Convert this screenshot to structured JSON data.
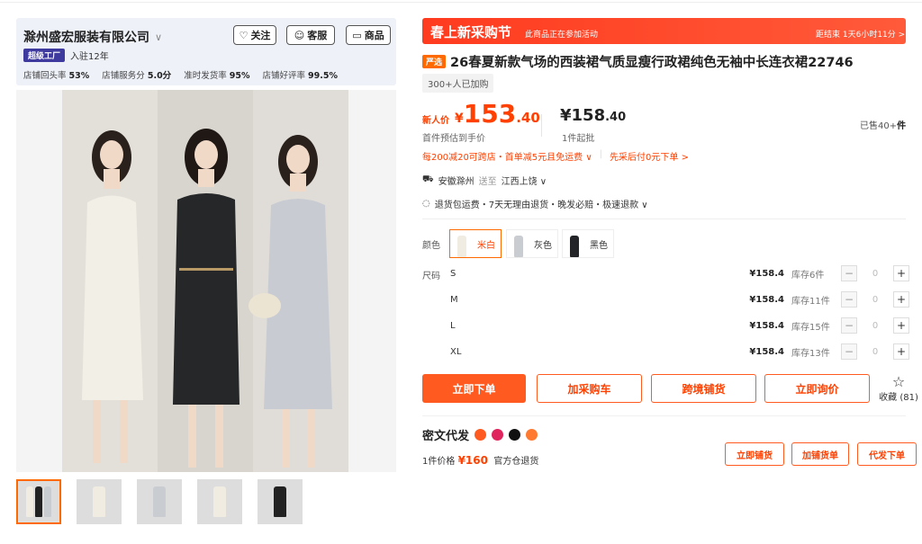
{
  "shop": {
    "name": "滁州盛宏服装有限公司",
    "follow_label": "关注",
    "service_label": "客服",
    "goods_label": "商品",
    "factory_badge": "超级工厂",
    "years": "入驻12年",
    "stats": [
      {
        "label": "店铺回头率",
        "value": "53%"
      },
      {
        "label": "店铺服务分",
        "value": "5.0分"
      },
      {
        "label": "准时发货率",
        "value": "95%"
      },
      {
        "label": "店铺好评率",
        "value": "99.5%"
      }
    ]
  },
  "promo": {
    "title": "春上新采购节",
    "subtitle": "此商品正在参加活动",
    "countdown": "距结束 1天6小时11分 >"
  },
  "product": {
    "tag": "严选",
    "title": "26春夏新款气场的西装裙气质显瘦行政裙纯色无袖中长连衣裙22746",
    "joined": "300+人已加购"
  },
  "price": {
    "new_label": "新人价",
    "currency": "¥",
    "new_int": "153",
    "new_dec": ".40",
    "new_note": "首件预估到手价",
    "base_int": "158",
    "base_dec": ".40",
    "base_note": "1件起批",
    "sold_prefix": "已售40+",
    "sold_unit": "件"
  },
  "offers": {
    "discount": "每200减20可跨店・首单减5元且免运费 ∨",
    "paylater": "先采后付0元下单 >"
  },
  "shipping": {
    "from": "安徽滁州",
    "to_word": "送至",
    "dest": "江西上饶 ∨"
  },
  "services": "退货包运费・7天无理由退货・晚发必赔・极速退款 ∨",
  "colors": {
    "label": "颜色",
    "options": [
      {
        "name": "米白",
        "swatch": "#f0ece2"
      },
      {
        "name": "灰色",
        "swatch": "#c9ccd1"
      },
      {
        "name": "黑色",
        "swatch": "#222428"
      }
    ]
  },
  "sizes": {
    "label": "尺码",
    "rows": [
      {
        "name": "S",
        "price": "¥158.4",
        "stock": "库存6件",
        "qty": "0"
      },
      {
        "name": "M",
        "price": "¥158.4",
        "stock": "库存11件",
        "qty": "0"
      },
      {
        "name": "L",
        "price": "¥158.4",
        "stock": "库存15件",
        "qty": "0"
      },
      {
        "name": "XL",
        "price": "¥158.4",
        "stock": "库存13件",
        "qty": "0"
      }
    ]
  },
  "actions": {
    "buy": "立即下单",
    "cart": "加采购车",
    "crossborder": "跨境铺货",
    "inquiry": "立即询价",
    "fav": "收藏 (81)"
  },
  "miwen": {
    "title": "密文代发",
    "price_prefix": "1件价格",
    "price": "¥160",
    "warehouse": "官方仓退货",
    "btn1": "立即铺货",
    "btn2": "加铺货单",
    "btn3": "代发下单"
  },
  "colors_theme": {
    "accent": "#ff5a1f",
    "price": "#ff4000",
    "shop_bg": "#eef1f8"
  }
}
